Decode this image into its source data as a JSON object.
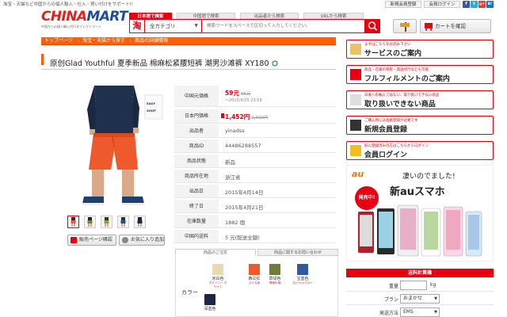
{
  "header": {
    "tagline": "淘宝・天猫など中国からの個人輸入・仕入・買い付けをサポート!!",
    "logo_red": "CHINA",
    "logo_blue": "MART",
    "logo_sub": "中国からの個人輸入代行ダイレクトマート",
    "search_tabs": [
      "日本語で検索",
      "中国語で検索",
      "出品者から検索",
      "URLから検索"
    ],
    "tao_glyph": "淘",
    "category": "全カテゴリ",
    "search_placeholder": "検索ワードをスペースで区切って入力してください。",
    "cart_label": "カートを確認",
    "new_member": "新規会員登録",
    "login": "会員ログイン",
    "social": [
      "f",
      "t",
      "g+",
      "B!"
    ]
  },
  "breadcrumb": [
    "トップページ",
    "淘宝・天猫から探す",
    "商品の詳細情報"
  ],
  "product": {
    "title": "原创Glad Youthful 夏季新品 棉麻松紧腰短裤 潮男沙滩裤 XY180",
    "photo_text_1": "EASY",
    "photo_text_2": "SHOP",
    "info": [
      {
        "label": "中国元価格",
        "value": "59元",
        "extra": "65元",
        "sub": "～2015/4/25 23:59"
      },
      {
        "label": "日本円価格",
        "value": "1,452円",
        "extra": "1,600円"
      },
      {
        "label": "出品者",
        "value": "yinadss"
      },
      {
        "label": "商品ID",
        "value": "44486288557"
      },
      {
        "label": "商品状態",
        "value": "新品"
      },
      {
        "label": "商品所在地",
        "value": "浙江省"
      },
      {
        "label": "出品日",
        "value": "2015年4月14日"
      },
      {
        "label": "終了日",
        "value": "2015年4月21日"
      },
      {
        "label": "在庫数量",
        "value": "1882 個"
      },
      {
        "label": "中国内送料",
        "value": "5 元(配送全額)"
      }
    ],
    "btn_view": "販売ページ確認",
    "btn_fav": "お気に入り追加",
    "tab_order": "商品のご注文",
    "tab_inquiry": "商品に関するお問い合わせ",
    "color_label": "カラー",
    "swatches": [
      {
        "name": "米白色",
        "sub": "グリーニー ホワイト"
      },
      {
        "name": "西瓜红",
        "sub": "スイカ赤"
      },
      {
        "name": "草绿色",
        "sub": "草緑の緑"
      },
      {
        "name": "宝蓝色",
        "sub": "ロイヤルブルー"
      },
      {
        "name": "深蓝色",
        "sub": ""
      }
    ]
  },
  "sidebar": {
    "banners": [
      {
        "small": "まずはこちらをお読み下さい",
        "big": "サービスのご案内"
      },
      {
        "small": "商品・在庫の保管・発送代行なども可能",
        "big": "フルフィルメントのご案内"
      },
      {
        "small": "日本への輸入ではない、取り扱いできない商品",
        "big": "取り扱いできない商品"
      },
      {
        "small": "ご購入時には会員登録が必要です",
        "big": "新規会員登録"
      },
      {
        "small": "既に登録済みの方はこちらからログイン",
        "big": "会員ログイン"
      }
    ],
    "au": {
      "brand": "au",
      "badge": "発売中!",
      "headline1": "凄いのでました!",
      "headline2": "新auスマホ"
    },
    "calc_title": "送料計算機",
    "calc_rows": [
      {
        "label": "重量",
        "value": "",
        "unit": "kg"
      },
      {
        "label": "プラン",
        "value": "おまかせ",
        "unit": ""
      },
      {
        "label": "発送方法",
        "value": "EMS",
        "unit": ""
      }
    ]
  }
}
